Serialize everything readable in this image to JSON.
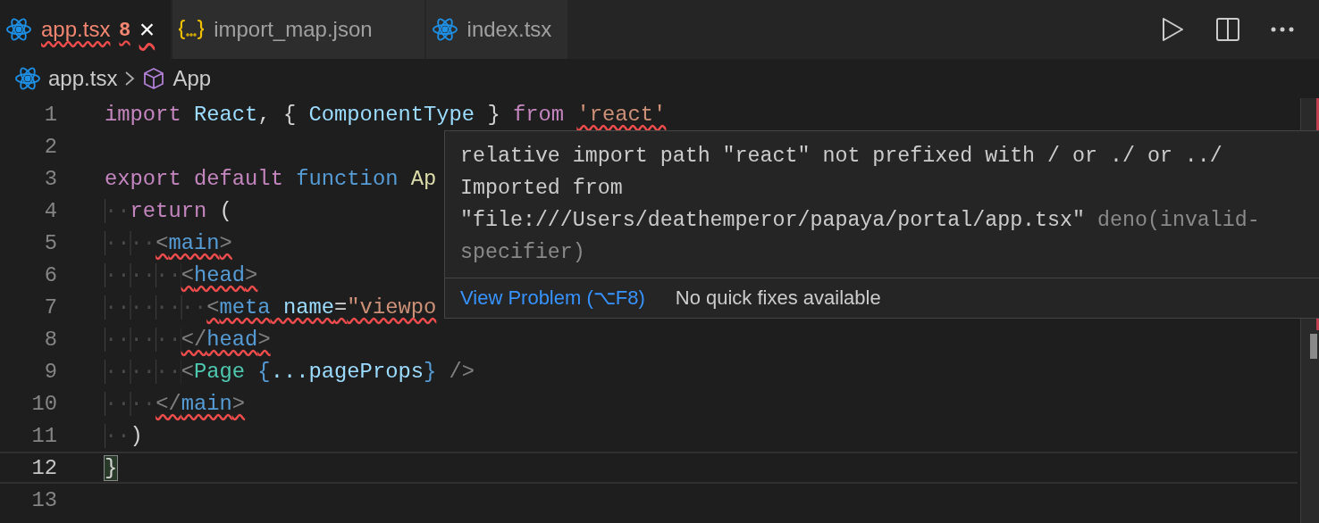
{
  "tabs": [
    {
      "label": "app.tsx",
      "kind": "react",
      "selected": true,
      "error": true,
      "badge": "8",
      "close": "×"
    },
    {
      "label": "import_map.json",
      "kind": "json",
      "selected": false,
      "error": false
    },
    {
      "label": "index.tsx",
      "kind": "react",
      "selected": false,
      "error": false
    }
  ],
  "breadcrumbs": [
    {
      "label": "app.tsx",
      "kind": "react"
    },
    {
      "label": "App",
      "kind": "symbol"
    }
  ],
  "lines": [
    {
      "number": "1",
      "current": false,
      "tokens": [
        {
          "kind": "kw",
          "text": "import",
          "error": false
        },
        {
          "kind": "var",
          "text": " React",
          "error": false
        },
        {
          "kind": "plain",
          "text": ", {",
          "error": false
        },
        {
          "kind": "var",
          "text": " ComponentType",
          "error": false
        },
        {
          "kind": "plain",
          "text": " }",
          "error": false
        },
        {
          "kind": "kw",
          "text": " from ",
          "error": false
        },
        {
          "kind": "str",
          "text": "'react'",
          "error": true
        }
      ]
    },
    {
      "number": "2",
      "current": false
    },
    {
      "number": "3",
      "current": false,
      "tokens": [
        {
          "kind": "kw",
          "text": "export",
          "error": false
        },
        {
          "kind": "kw",
          "text": " default",
          "error": false
        },
        {
          "kind": "fn",
          "text": " function",
          "error": false
        },
        {
          "kind": "name",
          "text": " Ap",
          "error": false
        }
      ]
    },
    {
      "number": "4",
      "current": false,
      "tokens": [
        {
          "kind": "ws",
          "text": "··",
          "error": false
        },
        {
          "kind": "kw",
          "text": "return",
          "error": false
        },
        {
          "kind": "plain",
          "text": " (",
          "error": false
        }
      ]
    },
    {
      "number": "5",
      "current": false,
      "tokens": [
        {
          "kind": "ws",
          "text": "····",
          "error": false
        },
        {
          "kind": "bracket",
          "text": "<",
          "error": true
        },
        {
          "kind": "tag",
          "text": "main",
          "error": true
        },
        {
          "kind": "bracket",
          "text": ">",
          "error": true
        }
      ]
    },
    {
      "number": "6",
      "current": false,
      "tokens": [
        {
          "kind": "ws",
          "text": "······",
          "error": false
        },
        {
          "kind": "bracket",
          "text": "<",
          "error": true
        },
        {
          "kind": "tag",
          "text": "head",
          "error": true
        },
        {
          "kind": "bracket",
          "text": ">",
          "error": true
        }
      ]
    },
    {
      "number": "7",
      "current": false,
      "tokens": [
        {
          "kind": "ws",
          "text": "········",
          "error": false
        },
        {
          "kind": "bracket",
          "text": "<",
          "error": true
        },
        {
          "kind": "tag",
          "text": "meta",
          "error": true
        },
        {
          "kind": "var",
          "text": " name",
          "error": true
        },
        {
          "kind": "plain",
          "text": "=",
          "error": true
        },
        {
          "kind": "str",
          "text": "\"viewpo",
          "error": true
        }
      ]
    },
    {
      "number": "8",
      "current": false,
      "tokens": [
        {
          "kind": "ws",
          "text": "······",
          "error": false
        },
        {
          "kind": "bracket",
          "text": "</",
          "error": true
        },
        {
          "kind": "tag",
          "text": "head",
          "error": true
        },
        {
          "kind": "bracket",
          "text": ">",
          "error": true
        }
      ]
    },
    {
      "number": "9",
      "current": false,
      "tokens": [
        {
          "kind": "ws",
          "text": "······",
          "error": false
        },
        {
          "kind": "bracket",
          "text": "<",
          "error": false
        },
        {
          "kind": "comp",
          "text": "Page",
          "error": false
        },
        {
          "kind": "fn",
          "text": " {",
          "error": false
        },
        {
          "kind": "var",
          "text": "...pageProps",
          "error": false
        },
        {
          "kind": "fn",
          "text": "}",
          "error": false
        },
        {
          "kind": "bracket",
          "text": " />",
          "error": false
        }
      ]
    },
    {
      "number": "10",
      "current": false,
      "tokens": [
        {
          "kind": "ws",
          "text": "····",
          "error": false
        },
        {
          "kind": "bracket",
          "text": "</",
          "error": true
        },
        {
          "kind": "tag",
          "text": "main",
          "error": true
        },
        {
          "kind": "bracket",
          "text": ">",
          "error": true
        }
      ]
    },
    {
      "number": "11",
      "current": false,
      "tokens": [
        {
          "kind": "ws",
          "text": "··",
          "error": false
        },
        {
          "kind": "plain",
          "text": ")",
          "error": false
        }
      ]
    },
    {
      "number": "12",
      "current": true,
      "tokens": [
        {
          "kind": "match",
          "text": "}",
          "error": false
        }
      ]
    },
    {
      "number": "13",
      "current": false
    }
  ],
  "hover": {
    "message": "relative import path \"react\" not prefixed with / or ./ or ../",
    "detail": "Imported from",
    "path": "\"file:///Users/deathemperor/papaya/portal/app.tsx\"",
    "source": "deno(invalid-specifier)",
    "link": "View Problem (⌥F8)",
    "note": "No quick fixes available"
  }
}
